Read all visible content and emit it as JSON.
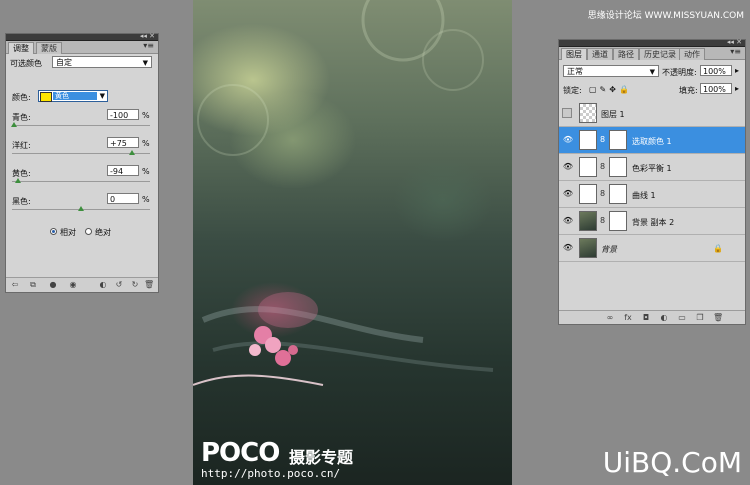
{
  "watermark": "思缘设计论坛 WWW.MISSYUAN.COM",
  "adjustments": {
    "tabs": [
      "调整",
      "蒙版"
    ],
    "preset_label": "可选颜色",
    "preset_value": "自定",
    "color_label": "颜色:",
    "color_value": "黄色",
    "sliders": [
      {
        "label": "青色:",
        "value": "-100",
        "level": -100
      },
      {
        "label": "洋红:",
        "value": "+75",
        "level": 75
      },
      {
        "label": "黄色:",
        "value": "-94",
        "level": -94
      },
      {
        "label": "黑色:",
        "value": "0",
        "level": 0
      }
    ],
    "percent_sign": "%",
    "radio_relative": "相对",
    "radio_absolute": "绝对"
  },
  "canvas": {
    "logo_text": "POCO",
    "logo_subtitle": "摄影专题",
    "logo_url": "http://photo.poco.cn/"
  },
  "layers": {
    "tabs": [
      "图层",
      "通道",
      "路径",
      "历史记录",
      "动作"
    ],
    "blend_mode": "正常",
    "opacity_label": "不透明度:",
    "opacity_value": "100%",
    "lock_label": "锁定:",
    "fill_label": "填充:",
    "fill_value": "100%",
    "rows": [
      {
        "name": "图层 1",
        "visible": false
      },
      {
        "name": "选取颜色 1",
        "visible": true,
        "selected": true
      },
      {
        "name": "色彩平衡 1",
        "visible": true
      },
      {
        "name": "曲线 1",
        "visible": true
      },
      {
        "name": "背景 副本 2",
        "visible": true
      },
      {
        "name": "背景",
        "visible": true,
        "locked": true
      }
    ]
  },
  "brand": {
    "watermark": "UiBQ.CoM"
  }
}
